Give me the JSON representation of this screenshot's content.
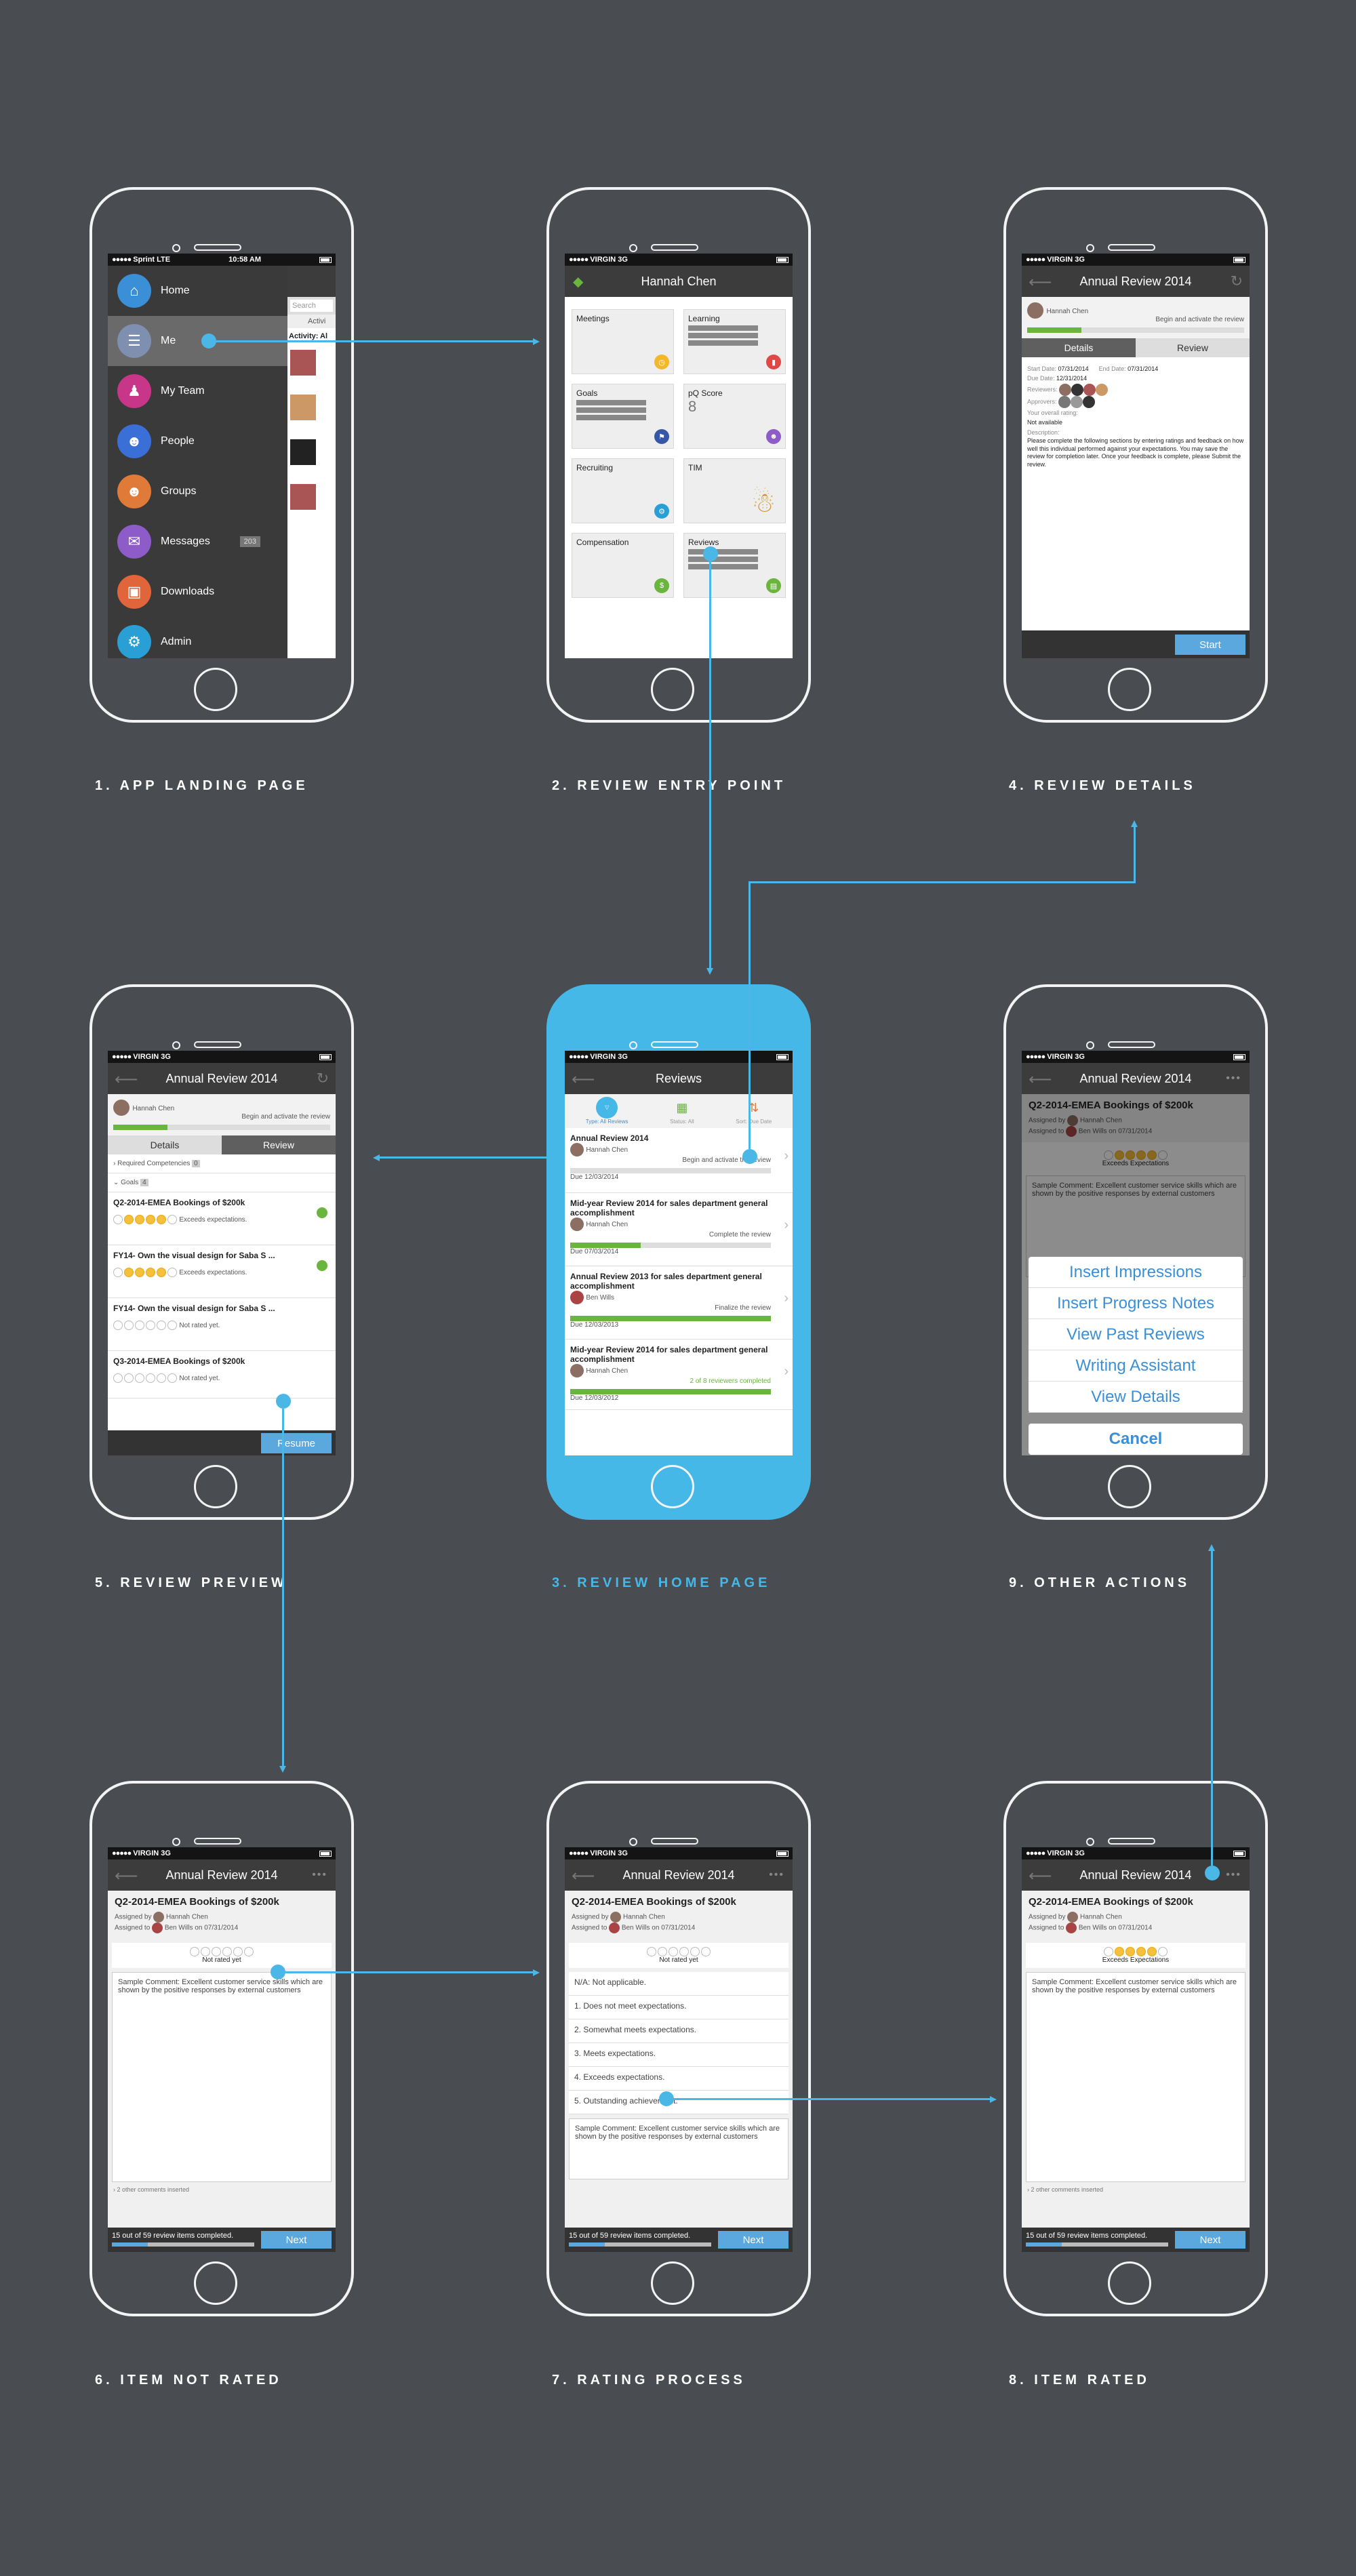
{
  "labels": {
    "l1": "1. APP LANDING PAGE",
    "l2": "2. REVIEW ENTRY POINT",
    "l3": "3. REVIEW HOME PAGE",
    "l4": "4. REVIEW DETAILS",
    "l5": "5. REVIEW PREVIEW",
    "l6": "6. ITEM NOT RATED",
    "l7": "7. RATING PROCESS",
    "l8": "8. ITEM RATED",
    "l9": "9. OTHER ACTIONS"
  },
  "p1": {
    "carrier": "Sprint",
    "network": "LTE",
    "time": "10:58 AM",
    "menu": [
      "Home",
      "Me",
      "My Team",
      "People",
      "Groups",
      "Messages",
      "Downloads",
      "Admin"
    ],
    "badge": "203",
    "search_placeholder": "Search",
    "feed_tab": "Activi",
    "feed_title": "Activity: Al"
  },
  "common": {
    "carrier": "VIRGIN",
    "network": "3G"
  },
  "p2": {
    "title": "Hannah Chen",
    "tiles": [
      "Meetings",
      "Learning",
      "Goals",
      "pQ Score",
      "Recruiting",
      "TIM",
      "Compensation",
      "Reviews"
    ],
    "pq_value": "8"
  },
  "p3": {
    "title": "Reviews",
    "filters": [
      "Type: All Reviews",
      "Status: All",
      "Sort: Due Date"
    ],
    "items": [
      {
        "title": "Annual Review 2014",
        "person": "Hannah Chen",
        "status": "Begin and activate the review",
        "due": "12/03/2014",
        "progress": 0
      },
      {
        "title": "Mid-year Review 2014 for sales department general accomplishment",
        "person": "Hannah Chen",
        "status": "Complete the review",
        "due": "07/03/2014",
        "progress": 35
      },
      {
        "title": "Annual Review 2013 for sales department general accomplishment",
        "person": "Ben Wills",
        "status": "Finalize the review",
        "due": "12/03/2013",
        "progress": 100
      },
      {
        "title": "Mid-year Review 2014 for sales department general accomplishment",
        "person": "Hannah Chen",
        "status": "2 of 8 reviewers completed",
        "due": "12/03/2012",
        "progress": 100
      }
    ],
    "due_label": "Due"
  },
  "p4": {
    "title": "Annual Review 2014",
    "person": "Hannah Chen",
    "status": "Begin and activate the review",
    "tabs": [
      "Details",
      "Review"
    ],
    "start_label": "Start Date:",
    "start": "07/31/2014",
    "end_label": "End Date:",
    "end": "07/31/2014",
    "due_label": "Due Date:",
    "due": "12/31/2014",
    "reviewers": "Reviewers:",
    "approvers": "Approvers:",
    "rating_label": "Your overall rating:",
    "rating": "Not available",
    "desc_label": "Description:",
    "desc": "Please complete the following sections by entering ratings and feedback on how well this individual performed against your expectations. You may save the review for completion later. Once your feedback is complete, please Submit the review.",
    "button": "Start"
  },
  "p5": {
    "title": "Annual Review 2014",
    "person": "Hannah Chen",
    "status": "Begin and activate the review",
    "tabs": [
      "Details",
      "Review"
    ],
    "sec1": "Required Competencies",
    "sec1_count": "0",
    "sec2": "Goals",
    "sec2_count": "4",
    "items": [
      {
        "title": "Q2-2014-EMEA Bookings of $200k",
        "rating": "Exceeds expectations."
      },
      {
        "title": "FY14- Own the visual design for Saba S ...",
        "rating": "Exceeds expectations."
      },
      {
        "title": "FY14- Own the visual design for Saba S ...",
        "rating": "Not rated yet."
      },
      {
        "title": "Q3-2014-EMEA Bookings of $200k",
        "rating": "Not rated yet."
      }
    ],
    "button": "Resume"
  },
  "item": {
    "title": "Annual Review 2014",
    "heading": "Q2-2014-EMEA Bookings of $200k",
    "assigned_by": "Assigned by",
    "assigned_to": "Assigned to",
    "by": "Hannah Chen",
    "to": "Ben Wills",
    "on": "on",
    "date": "07/31/2014",
    "not_rated": "Not rated yet",
    "exceeds": "Exceeds Expectations",
    "comment": "Sample Comment: Excellent customer service skills which are shown by the positive responses by external customers",
    "other": "2 other comments inserted",
    "footer": "15 out of 59 review items completed.",
    "next": "Next",
    "scale": [
      "N/A: Not applicable.",
      "1. Does not meet expectations.",
      "2. Somewhat meets expectations.",
      "3. Meets expectations.",
      "4. Exceeds expectations.",
      "5. Outstanding achievement."
    ]
  },
  "p9": {
    "actions": [
      "Insert Impressions",
      "Insert Progress Notes",
      "View Past Reviews",
      "Writing Assistant",
      "View Details"
    ],
    "cancel": "Cancel"
  }
}
